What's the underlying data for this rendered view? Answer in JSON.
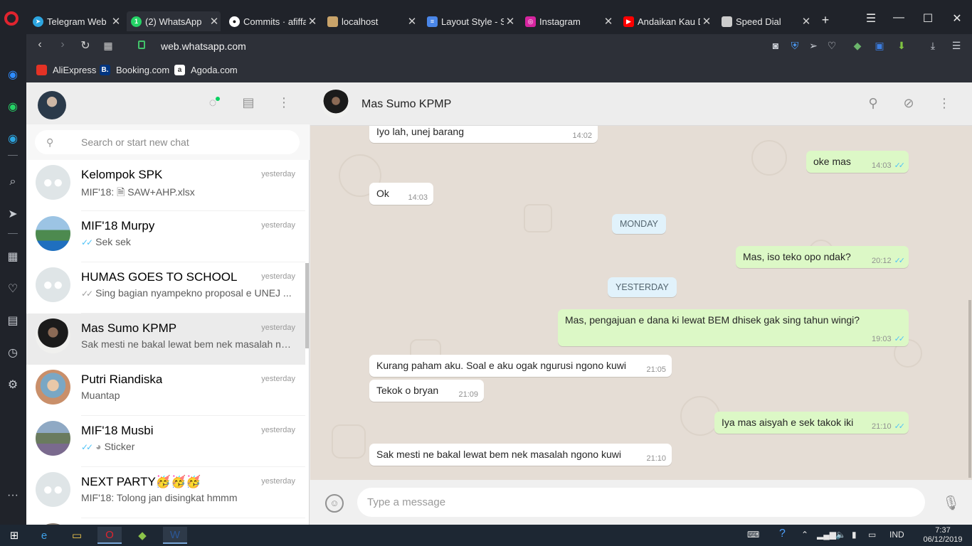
{
  "browser": {
    "tabs": [
      {
        "label": "Telegram Web",
        "icon": "telegram-icon",
        "color": "#2ca5e0"
      },
      {
        "label": "(2) WhatsApp",
        "icon": "whatsapp-icon",
        "color": "#25d366",
        "active": true
      },
      {
        "label": "Commits · afiffa",
        "icon": "github-icon",
        "color": "#ffffff"
      },
      {
        "label": "localhost",
        "icon": "localhost-icon",
        "color": "#c9a36a"
      },
      {
        "label": "Layout Style - Sp",
        "icon": "docs-icon",
        "color": "#4a86e8"
      },
      {
        "label": "Instagram",
        "icon": "instagram-icon",
        "color": "#d6249f"
      },
      {
        "label": "Andaikan Kau D",
        "icon": "youtube-icon",
        "color": "#ff0000"
      },
      {
        "label": "Speed Dial",
        "icon": "speed-dial-icon",
        "color": "#cccccc"
      }
    ],
    "new_tab": "+",
    "url_host": "web.whatsapp.com",
    "bookmarks": [
      {
        "label": "AliExpress",
        "icon": "aliexpress-icon",
        "color": "#e43225"
      },
      {
        "label": "Booking.com",
        "icon": "booking-icon",
        "color": "#003580",
        "glyph": "B."
      },
      {
        "label": "Agoda.com",
        "icon": "agoda-icon",
        "color": "#ffffff",
        "glyph": "a"
      }
    ]
  },
  "whatsapp": {
    "search_placeholder": "Search or start new chat",
    "chats": [
      {
        "name": "Kelompok SPK",
        "time": "yesterday",
        "last": "MIF'18: 🗎 SAW+AHP.xlsx",
        "avatar": "group",
        "tick": ""
      },
      {
        "name": "MIF'18 Murpy",
        "time": "yesterday",
        "last": "Sek sek",
        "avatar": "photo",
        "tick": "blue"
      },
      {
        "name": "HUMAS GOES TO SCHOOL",
        "time": "yesterday",
        "last": "Sing bagian nyampekno proposal e UNEJ ...",
        "avatar": "group",
        "tick": "grey"
      },
      {
        "name": "Mas Sumo KPMP",
        "time": "yesterday",
        "last": "Sak mesti ne bakal lewat bem nek masalah ng...",
        "avatar": "photo",
        "tick": "",
        "selected": true
      },
      {
        "name": "Putri Riandiska",
        "time": "yesterday",
        "last": "Muantap",
        "avatar": "photo",
        "tick": ""
      },
      {
        "name": "MIF'18 Musbi",
        "time": "yesterday",
        "last": "Sticker",
        "avatar": "photo",
        "tick": "blue"
      },
      {
        "name": "NEXT PARTY🥳🥳🥳",
        "time": "yesterday",
        "last": "MIF'18: Tolong jan disingkat hmmm",
        "avatar": "group",
        "tick": ""
      }
    ],
    "conversation": {
      "contact_name": "Mas Sumo KPMP",
      "input_placeholder": "Type a message",
      "day_labels": {
        "monday": "MONDAY",
        "yesterday": "YESTERDAY"
      },
      "messages": [
        {
          "text": "Iyo lah, unej barang",
          "time": "14:02",
          "dir": "in"
        },
        {
          "text": "oke mas",
          "time": "14:03",
          "dir": "out"
        },
        {
          "text": "Ok",
          "time": "14:03",
          "dir": "in"
        },
        {
          "text": "Mas, iso teko opo ndak?",
          "time": "20:12",
          "dir": "out"
        },
        {
          "text": "Mas, pengajuan e dana ki lewat BEM dhisek gak sing tahun wingi?",
          "time": "19:03",
          "dir": "out"
        },
        {
          "text": "Kurang paham aku. Soal e aku ogak ngurusi ngono kuwi",
          "time": "21:05",
          "dir": "in"
        },
        {
          "text": "Tekok o bryan",
          "time": "21:09",
          "dir": "in"
        },
        {
          "text": "Iya mas aisyah e sek takok iki",
          "time": "21:10",
          "dir": "out"
        },
        {
          "text": "Sak mesti ne bakal lewat bem nek masalah ngono kuwi",
          "time": "21:10",
          "dir": "in"
        }
      ]
    }
  },
  "taskbar": {
    "language": "IND",
    "time": "7:37",
    "date": "06/12/2019"
  },
  "colors": {
    "wa_green_bubble": "#dcf8c6",
    "wa_chat_bg": "#e5ddd5",
    "read_tick": "#4fc3f7",
    "opera_red": "#e0242f"
  }
}
